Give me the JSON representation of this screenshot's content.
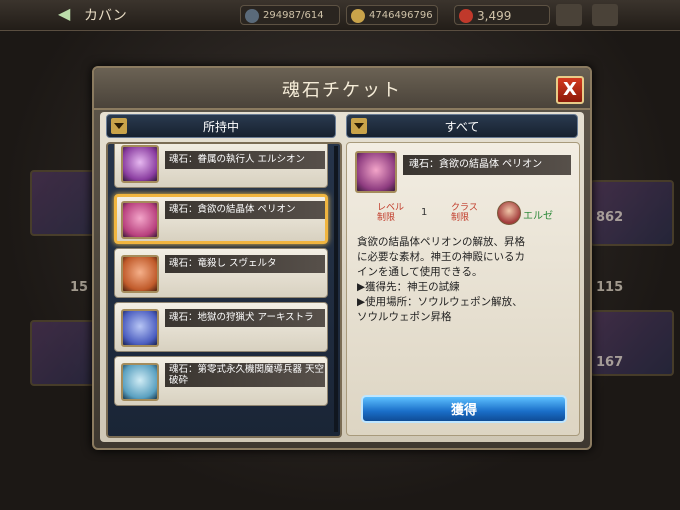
{
  "topbar": {
    "title": "カバン",
    "stat1": "294987/614",
    "stat2": "4746496796",
    "stat3": "3,499"
  },
  "side_numbers": {
    "left1": "15",
    "right1": "862",
    "right2": "115",
    "right3": "167"
  },
  "dialog": {
    "title": "魂石チケット",
    "close": "X",
    "filter_owned": "所持中",
    "filter_all": "すべて",
    "items": [
      {
        "name": "魂石：眷属の執行人 エルシオン",
        "selected": false
      },
      {
        "name": "魂石：貪欲の結晶体 ペリオン",
        "selected": true
      },
      {
        "name": "魂石：竜殺し スヴェルタ",
        "selected": false
      },
      {
        "name": "魂石：地獄の狩猟犬 アーキストラ",
        "selected": false
      },
      {
        "name": "魂石：第零式永久機関魔導兵器 天空破砕",
        "selected": false
      }
    ],
    "detail": {
      "name": "魂石：貪欲の結晶体 ペリオン",
      "level_label_1": "レベル",
      "level_label_2": "制限",
      "level_value": "1",
      "class_label_1": "クラス",
      "class_label_2": "制限",
      "class_value": "エルゼ",
      "desc": [
        "貪欲の結晶体ペリオンの解放、昇格",
        "に必要な素材。神王の神殿にいるカ",
        "インを通して使用できる。",
        "▶獲得先：神王の試練",
        "▶使用場所：ソウルウェポン解放、",
        "ソウルウェポン昇格"
      ],
      "get_button": "獲得"
    }
  }
}
